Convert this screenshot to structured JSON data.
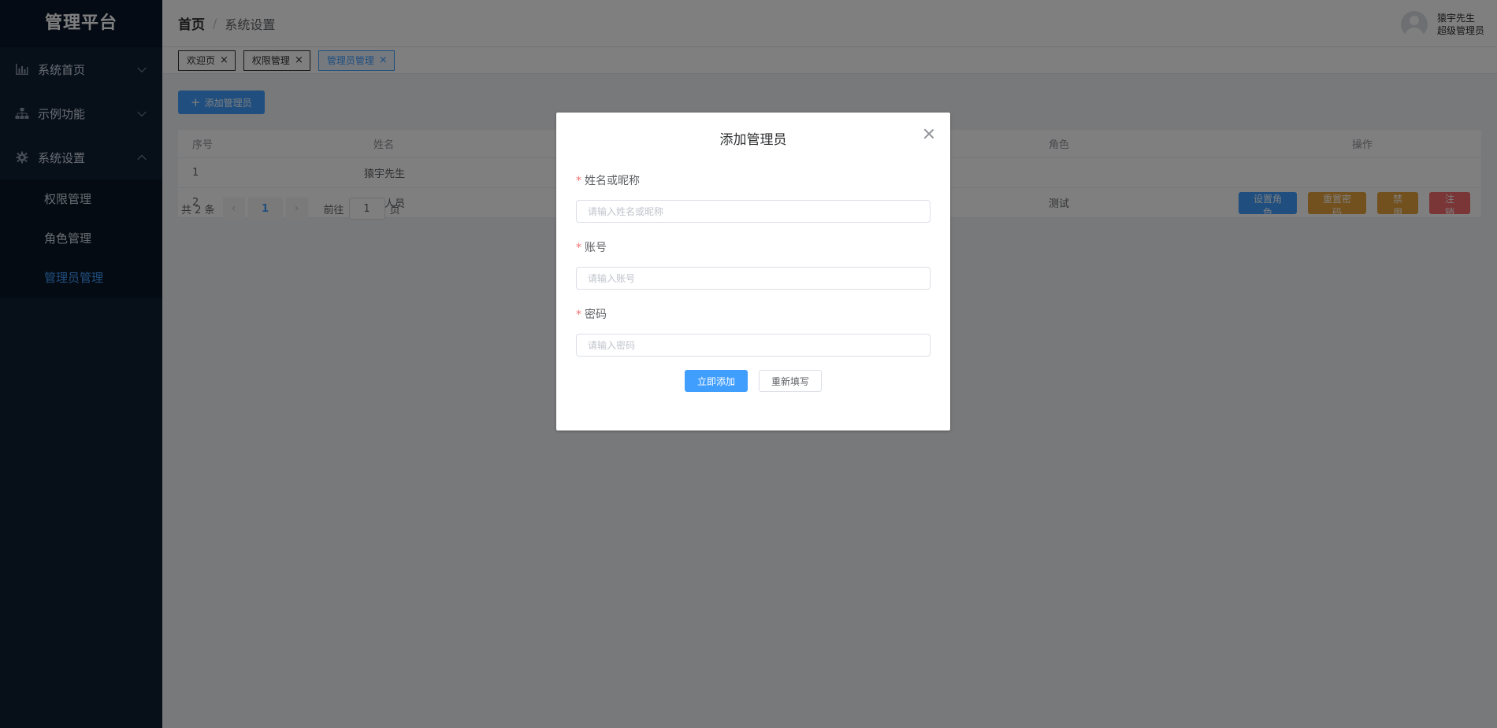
{
  "sidebar": {
    "brand": "管理平台",
    "menus": [
      {
        "label": "系统首页",
        "icon": "bar-chart-icon"
      },
      {
        "label": "示例功能",
        "icon": "sitemap-icon"
      },
      {
        "label": "系统设置",
        "icon": "gear-icon"
      }
    ],
    "submenu": [
      "权限管理",
      "角色管理",
      "管理员管理"
    ],
    "active_submenu": "管理员管理"
  },
  "header": {
    "crumb_home": "首页",
    "crumb_sep": "/",
    "crumb_current": "系统设置",
    "user_name": "猿宇先生",
    "user_role": "超级管理员"
  },
  "tags": [
    {
      "label": "欢迎页",
      "active": false
    },
    {
      "label": "权限管理",
      "active": false
    },
    {
      "label": "管理员管理",
      "active": true
    }
  ],
  "tag_close": "×",
  "toolbar": {
    "add_icon": "+",
    "add_label": "添加管理员"
  },
  "table": {
    "columns": {
      "index": "序号",
      "name": "姓名",
      "role": "角色",
      "ops": "操作"
    },
    "rows": [
      {
        "index": "1",
        "name": "猿宇先生",
        "role": ""
      },
      {
        "index": "2",
        "name": "测试人员",
        "role": "测试"
      }
    ],
    "row_actions": [
      "设置角色",
      "重置密码",
      "禁用",
      "注销"
    ]
  },
  "pagination": {
    "total": "共 2 条",
    "prev": "‹",
    "current": "1",
    "next": "›",
    "jump_prefix": "前往",
    "jump_value": "1",
    "jump_suffix": "页"
  },
  "dialog": {
    "title": "添加管理员",
    "required_mark": "*",
    "fields": [
      {
        "label": "姓名或昵称",
        "placeholder": "请输入姓名或昵称"
      },
      {
        "label": "账号",
        "placeholder": "请输入账号"
      },
      {
        "label": "密码",
        "placeholder": "请输入密码"
      }
    ],
    "submit_label": "立即添加",
    "reset_label": "重新填写"
  },
  "colors": {
    "primary": "#409eff",
    "warning": "#e6a23c",
    "danger": "#f56c6c",
    "sidebar_bg": "#0f1e33"
  }
}
